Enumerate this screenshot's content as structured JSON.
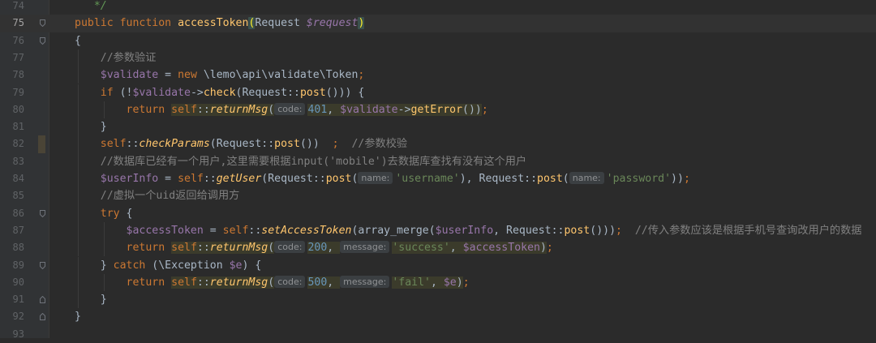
{
  "editor": {
    "lines": [
      {
        "n": "74",
        "tokens": [
          {
            "t": "   ",
            "c": ""
          },
          {
            "t": "*/",
            "c": "doc"
          }
        ]
      },
      {
        "n": "75",
        "current": true,
        "tokens": [
          {
            "t": "public",
            "c": "kw"
          },
          {
            "t": " ",
            "c": ""
          },
          {
            "t": "function",
            "c": "kw"
          },
          {
            "t": " ",
            "c": ""
          },
          {
            "t": "accessToken",
            "c": "fn"
          },
          {
            "t": "(",
            "c": "brm"
          },
          {
            "t": "Request ",
            "c": ""
          },
          {
            "t": "$request",
            "c": "param"
          },
          {
            "t": ")",
            "c": "brm"
          }
        ]
      },
      {
        "n": "76",
        "tokens": [
          {
            "t": "{",
            "c": ""
          }
        ]
      },
      {
        "n": "77",
        "tokens": [
          {
            "t": "    ",
            "c": ""
          },
          {
            "t": "//参数验证",
            "c": "cm"
          }
        ]
      },
      {
        "n": "78",
        "tokens": [
          {
            "t": "    ",
            "c": ""
          },
          {
            "t": "$validate",
            "c": "var"
          },
          {
            "t": " = ",
            "c": ""
          },
          {
            "t": "new",
            "c": "kw"
          },
          {
            "t": " \\lemo\\api\\validate\\Token",
            "c": ""
          },
          {
            "t": ";",
            "c": "kw"
          }
        ]
      },
      {
        "n": "79",
        "tokens": [
          {
            "t": "    ",
            "c": ""
          },
          {
            "t": "if",
            "c": "kw"
          },
          {
            "t": " (!",
            "c": ""
          },
          {
            "t": "$validate",
            "c": "var"
          },
          {
            "t": "->",
            "c": ""
          },
          {
            "t": "check",
            "c": "fn"
          },
          {
            "t": "(Request::",
            "c": ""
          },
          {
            "t": "post",
            "c": "fn"
          },
          {
            "t": "())) {",
            "c": ""
          }
        ]
      },
      {
        "n": "80",
        "tokens": [
          {
            "t": "        ",
            "c": ""
          },
          {
            "t": "return",
            "c": "kw"
          },
          {
            "t": " ",
            "c": ""
          },
          {
            "t": "self",
            "c": "self hl"
          },
          {
            "t": "::",
            "c": "hl"
          },
          {
            "t": "returnMsg",
            "c": "st hl"
          },
          {
            "t": "(",
            "c": "hl"
          },
          {
            "h": "code:"
          },
          {
            "t": "401",
            "c": "num hl"
          },
          {
            "t": ", ",
            "c": "hl"
          },
          {
            "t": "$validate",
            "c": "var hl"
          },
          {
            "t": "->",
            "c": "hl"
          },
          {
            "t": "getError",
            "c": "fn hl"
          },
          {
            "t": "())",
            "c": "hl"
          },
          {
            "t": ";",
            "c": "kw"
          }
        ]
      },
      {
        "n": "81",
        "tokens": [
          {
            "t": "    ",
            "c": ""
          },
          {
            "t": "}",
            "c": ""
          }
        ]
      },
      {
        "n": "82",
        "tokens": [
          {
            "t": "    ",
            "c": ""
          },
          {
            "t": "self",
            "c": "self"
          },
          {
            "t": "::",
            "c": ""
          },
          {
            "t": "checkParams",
            "c": "st"
          },
          {
            "t": "(Request::",
            "c": ""
          },
          {
            "t": "post",
            "c": "fn"
          },
          {
            "t": "())  ",
            "c": ""
          },
          {
            "t": ";",
            "c": "kw"
          },
          {
            "t": "  ",
            "c": ""
          },
          {
            "t": "//参数校验",
            "c": "cm"
          }
        ]
      },
      {
        "n": "83",
        "tokens": [
          {
            "t": "    ",
            "c": ""
          },
          {
            "t": "//数据库已经有一个用户,这里需要根据input('mobile')去数据库查找有没有这个用户",
            "c": "cm"
          }
        ]
      },
      {
        "n": "84",
        "tokens": [
          {
            "t": "    ",
            "c": ""
          },
          {
            "t": "$userInfo",
            "c": "var"
          },
          {
            "t": " = ",
            "c": ""
          },
          {
            "t": "self",
            "c": "self"
          },
          {
            "t": "::",
            "c": ""
          },
          {
            "t": "getUser",
            "c": "st"
          },
          {
            "t": "(Request::",
            "c": ""
          },
          {
            "t": "post",
            "c": "fn"
          },
          {
            "t": "(",
            "c": ""
          },
          {
            "h": "name:"
          },
          {
            "t": "'username'",
            "c": "str"
          },
          {
            "t": "), Request::",
            "c": ""
          },
          {
            "t": "post",
            "c": "fn"
          },
          {
            "t": "(",
            "c": ""
          },
          {
            "h": "name:"
          },
          {
            "t": "'password'",
            "c": "str"
          },
          {
            "t": "))",
            "c": ""
          },
          {
            "t": ";",
            "c": "kw"
          }
        ]
      },
      {
        "n": "85",
        "tokens": [
          {
            "t": "    ",
            "c": ""
          },
          {
            "t": "//虚拟一个uid返回给调用方",
            "c": "cm"
          }
        ]
      },
      {
        "n": "86",
        "tokens": [
          {
            "t": "    ",
            "c": ""
          },
          {
            "t": "try",
            "c": "kw"
          },
          {
            "t": " {",
            "c": ""
          }
        ]
      },
      {
        "n": "87",
        "tokens": [
          {
            "t": "        ",
            "c": ""
          },
          {
            "t": "$accessToken",
            "c": "var"
          },
          {
            "t": " = ",
            "c": ""
          },
          {
            "t": "self",
            "c": "self"
          },
          {
            "t": "::",
            "c": ""
          },
          {
            "t": "setAccessToken",
            "c": "st"
          },
          {
            "t": "(array_merge(",
            "c": ""
          },
          {
            "t": "$userInfo",
            "c": "var"
          },
          {
            "t": ", Request::",
            "c": ""
          },
          {
            "t": "post",
            "c": "fn"
          },
          {
            "t": "()))",
            "c": ""
          },
          {
            "t": ";",
            "c": "kw"
          },
          {
            "t": "  ",
            "c": ""
          },
          {
            "t": "//传入参数应该是根据手机号查询改用户的数据",
            "c": "cm"
          }
        ]
      },
      {
        "n": "88",
        "tokens": [
          {
            "t": "        ",
            "c": ""
          },
          {
            "t": "return",
            "c": "kw"
          },
          {
            "t": " ",
            "c": ""
          },
          {
            "t": "self",
            "c": "self hl"
          },
          {
            "t": "::",
            "c": "hl"
          },
          {
            "t": "returnMsg",
            "c": "st hl"
          },
          {
            "t": "(",
            "c": "hl"
          },
          {
            "h": "code:"
          },
          {
            "t": "200",
            "c": "num hl"
          },
          {
            "t": ", ",
            "c": "hl"
          },
          {
            "h": "message:"
          },
          {
            "t": "'success'",
            "c": "str hl"
          },
          {
            "t": ", ",
            "c": "hl"
          },
          {
            "t": "$accessToken",
            "c": "var hl"
          },
          {
            "t": ")",
            "c": "hl"
          },
          {
            "t": ";",
            "c": "kw"
          }
        ]
      },
      {
        "n": "89",
        "tokens": [
          {
            "t": "    ",
            "c": ""
          },
          {
            "t": "} ",
            "c": ""
          },
          {
            "t": "catch",
            "c": "kw"
          },
          {
            "t": " (\\Exception ",
            "c": ""
          },
          {
            "t": "$e",
            "c": "var"
          },
          {
            "t": ") {",
            "c": ""
          }
        ]
      },
      {
        "n": "90",
        "tokens": [
          {
            "t": "        ",
            "c": ""
          },
          {
            "t": "return",
            "c": "kw"
          },
          {
            "t": " ",
            "c": ""
          },
          {
            "t": "self",
            "c": "self hl"
          },
          {
            "t": "::",
            "c": "hl"
          },
          {
            "t": "returnMsg",
            "c": "st hl"
          },
          {
            "t": "(",
            "c": "hl"
          },
          {
            "h": "code:"
          },
          {
            "t": "500",
            "c": "num hl"
          },
          {
            "t": ", ",
            "c": "hl"
          },
          {
            "h": "message:"
          },
          {
            "t": "'fail'",
            "c": "str hl"
          },
          {
            "t": ", ",
            "c": "hl"
          },
          {
            "t": "$e",
            "c": "var hl"
          },
          {
            "t": ")",
            "c": "hl"
          },
          {
            "t": ";",
            "c": "kw"
          }
        ]
      },
      {
        "n": "91",
        "tokens": [
          {
            "t": "    ",
            "c": ""
          },
          {
            "t": "}",
            "c": ""
          }
        ]
      },
      {
        "n": "92",
        "tokens": [
          {
            "t": "}",
            "c": ""
          }
        ]
      },
      {
        "n": "93",
        "tokens": []
      }
    ]
  }
}
